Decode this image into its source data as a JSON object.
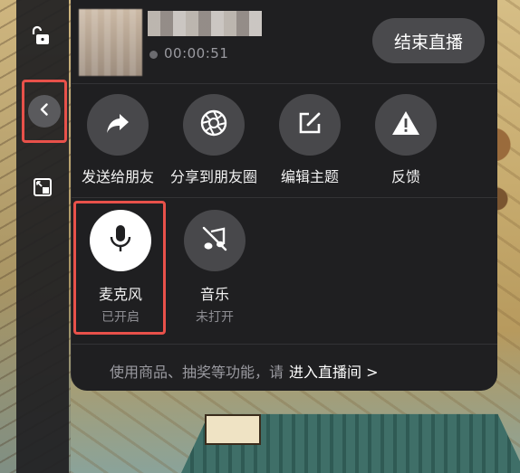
{
  "header": {
    "timer": "00:00:51",
    "end_button": "结束直播"
  },
  "share_actions": [
    {
      "label": "发送给朋友",
      "icon": "share-arrow-icon"
    },
    {
      "label": "分享到朋友圈",
      "icon": "moments-shutter-icon"
    },
    {
      "label": "编辑主题",
      "icon": "edit-icon"
    },
    {
      "label": "反馈",
      "icon": "warning-icon"
    }
  ],
  "tools": [
    {
      "label": "麦克风",
      "status": "已开启",
      "icon": "microphone-icon",
      "on": true
    },
    {
      "label": "音乐",
      "status": "未打开",
      "icon": "music-off-icon",
      "on": false
    }
  ],
  "footer": {
    "text": "使用商品、抽奖等功能，请",
    "link": "进入直播间 >"
  },
  "colors": {
    "panel": "#1f1f21",
    "circle": "#48484b",
    "highlight": "#e8514a"
  }
}
